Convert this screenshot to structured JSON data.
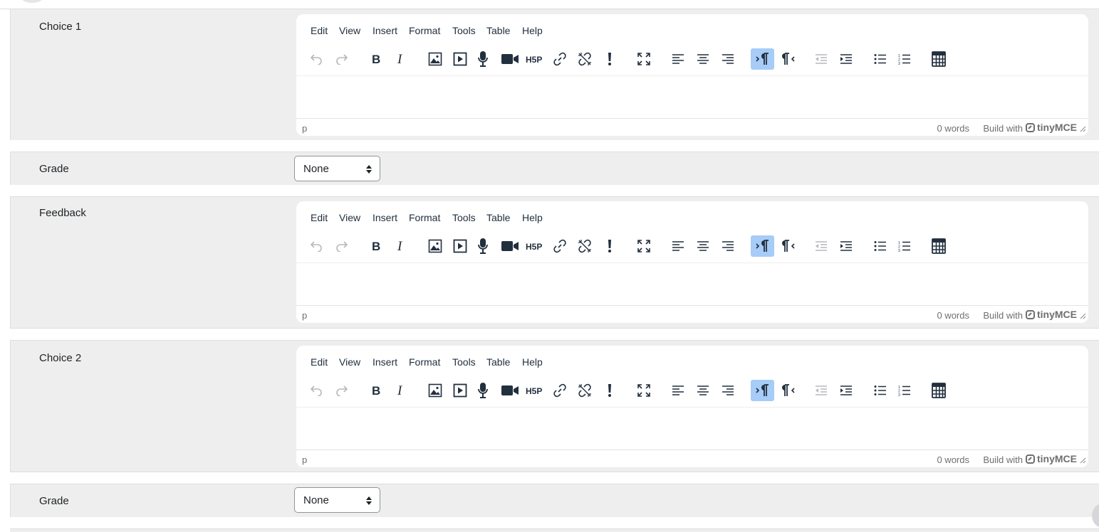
{
  "menus": [
    "Edit",
    "View",
    "Insert",
    "Format",
    "Tools",
    "Table",
    "Help"
  ],
  "status": {
    "path": "p",
    "words": "0 words",
    "build": "Build with",
    "brand": "tinyMCE"
  },
  "sections": {
    "choice1": {
      "label": "Choice 1"
    },
    "grade1": {
      "label": "Grade",
      "value": "None"
    },
    "feedback": {
      "label": "Feedback"
    },
    "choice2": {
      "label": "Choice 2"
    },
    "grade2": {
      "label": "Grade",
      "value": "None"
    }
  },
  "toolbar_buttons": [
    "undo-icon",
    "redo-icon",
    "bold-icon",
    "italic-icon",
    "image-icon",
    "media-icon",
    "record-audio-icon",
    "record-video-icon",
    "h5p-icon",
    "link-icon",
    "unlink-icon",
    "exclamation-icon",
    "fullscreen-icon",
    "align-left-icon",
    "align-center-icon",
    "align-right-icon",
    "ltr-icon",
    "rtl-icon",
    "outdent-icon",
    "indent-icon",
    "bullet-list-icon",
    "numbered-list-icon",
    "calculator-icon"
  ],
  "colors": {
    "section_bg": "#eeeeee",
    "active_button": "#a6ccf7"
  }
}
